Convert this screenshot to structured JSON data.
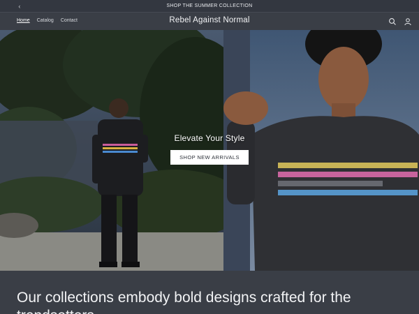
{
  "announcement": {
    "text": "SHOP THE SUMMER COLLECTION"
  },
  "header": {
    "nav": [
      {
        "label": "Home"
      },
      {
        "label": "Catalog"
      },
      {
        "label": "Contact"
      }
    ],
    "brand": "Rebel Against Normal"
  },
  "hero": {
    "title": "Elevate Your Style",
    "button_label": "SHOP NEW ARRIVALS"
  },
  "intro": {
    "text": "Our collections embody bold designs crafted for the trendsetters"
  },
  "colors": {
    "background": "#3a3e46",
    "announcement_bg": "#333740",
    "button_bg": "#ffffff",
    "button_text": "#2c3038"
  },
  "icons": [
    "chevron-left-icon",
    "search-icon",
    "account-icon"
  ]
}
